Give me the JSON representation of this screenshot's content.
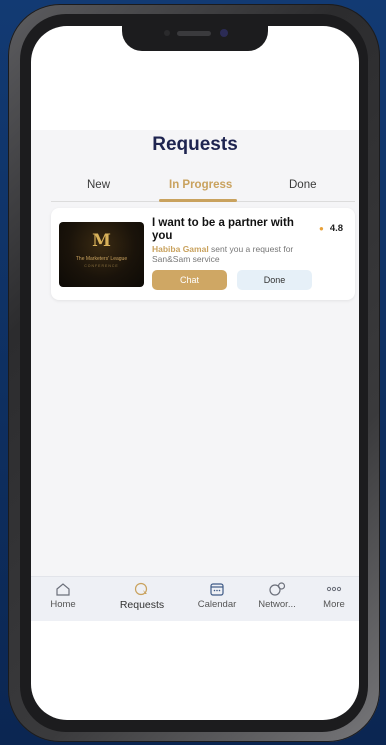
{
  "screen": {
    "title": "Requests"
  },
  "tabs": [
    {
      "label": "New"
    },
    {
      "label": "In Progress"
    },
    {
      "label": "Done"
    }
  ],
  "request_card": {
    "title": "I want to be a partner with you",
    "rating": "4.8",
    "requester": "Habiba Gamal",
    "message": " sent you a request for San&Sam service",
    "thumbnail_logo": "M",
    "thumbnail_text": "The Marketers' League",
    "thumbnail_subtext": "CONFERENCE",
    "chat_label": "Chat",
    "done_label": "Done"
  },
  "bottom_nav": [
    {
      "label": "Home",
      "icon": "home-icon"
    },
    {
      "label": "Requests",
      "icon": "requests-icon"
    },
    {
      "label": "Calendar",
      "icon": "calendar-icon"
    },
    {
      "label": "Networ...",
      "icon": "network-icon"
    },
    {
      "label": "More",
      "icon": "more-icon"
    }
  ],
  "colors": {
    "accent_gold": "#c9a25e",
    "title_navy": "#1e2450",
    "background_blue": "#123a73"
  }
}
